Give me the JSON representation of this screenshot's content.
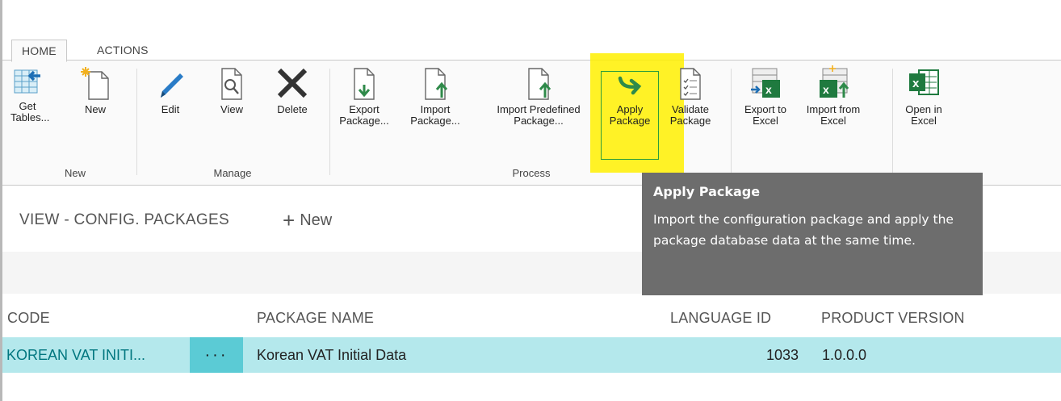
{
  "ribbon": {
    "tabs": [
      {
        "label": "HOME",
        "active": true
      },
      {
        "label": "ACTIONS",
        "active": false
      }
    ],
    "buttons": {
      "get_tables": "Get\nTables...",
      "new": "New",
      "edit": "Edit",
      "view": "View",
      "delete": "Delete",
      "export_package": "Export\nPackage...",
      "import_package": "Import\nPackage...",
      "import_predefined": "Import Predefined\nPackage...",
      "apply_package": "Apply\nPackage",
      "validate_package": "Validate\nPackage",
      "export_excel": "Export to\nExcel",
      "import_excel": "Import from\nExcel",
      "open_excel": "Open in\nExcel"
    },
    "groups": {
      "new": "New",
      "manage": "Manage",
      "process": "Process"
    }
  },
  "tooltip": {
    "title": "Apply Package",
    "body": "Import the configuration package and apply the package database data at the same time."
  },
  "page": {
    "title": "VIEW - CONFIG. PACKAGES",
    "new_label": "New"
  },
  "table": {
    "columns": [
      "CODE",
      "PACKAGE NAME",
      "LANGUAGE ID",
      "PRODUCT VERSION"
    ],
    "rows": [
      {
        "code": "KOREAN VAT INITI...",
        "more": "···",
        "package_name": "Korean VAT Initial Data",
        "language_id": "1033",
        "product_version": "1.0.0.0"
      }
    ]
  },
  "colors": {
    "accent": "#00767f",
    "row_selected": "#b4e8ec",
    "highlight": "#fff000",
    "tooltip_bg": "#6d6d6d"
  }
}
